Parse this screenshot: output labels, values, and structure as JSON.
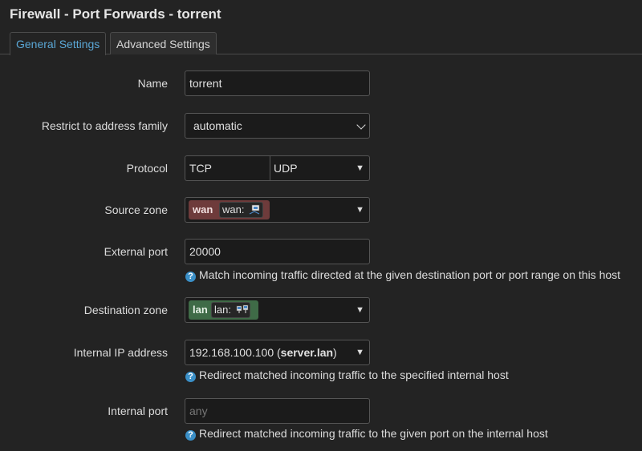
{
  "page": {
    "title": "Firewall - Port Forwards - torrent"
  },
  "tabs": [
    {
      "label": "General Settings"
    },
    {
      "label": "Advanced Settings"
    }
  ],
  "form": {
    "name": {
      "label": "Name",
      "value": "torrent"
    },
    "family": {
      "label": "Restrict to address family",
      "value": "automatic"
    },
    "protocol": {
      "label": "Protocol",
      "values": [
        "TCP",
        "UDP"
      ]
    },
    "source_zone": {
      "label": "Source zone",
      "badge": "wan",
      "inner": "wan:"
    },
    "external_port": {
      "label": "External port",
      "value": "20000",
      "help": "Match incoming traffic directed at the given destination port or port range on this host"
    },
    "dest_zone": {
      "label": "Destination zone",
      "badge": "lan",
      "inner": "lan:"
    },
    "internal_ip": {
      "label": "Internal IP address",
      "ip": "192.168.100.100 (",
      "host": "server.lan",
      "close": ")",
      "help": "Redirect matched incoming traffic to the specified internal host"
    },
    "internal_port": {
      "label": "Internal port",
      "placeholder": "any",
      "help": "Redirect matched incoming traffic to the given port on the internal host"
    }
  },
  "icons": {
    "help": "question-circle-icon",
    "caret": "caret-down-icon",
    "network": "network-icon"
  },
  "colors": {
    "accent": "#5aa7d6",
    "wan": "#6e3b3b",
    "lan": "#3f6b47",
    "help": "#3a8fc7"
  }
}
